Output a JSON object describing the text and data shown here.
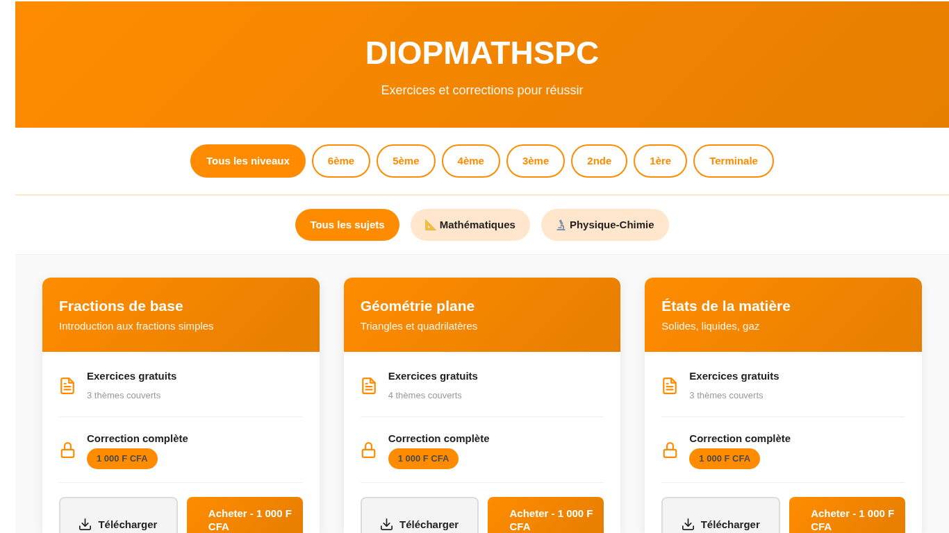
{
  "header": {
    "title": "DIOPMATHSPC",
    "subtitle": "Exercices et corrections pour réussir"
  },
  "level_filters": [
    {
      "label": "Tous les niveaux",
      "selected": true
    },
    {
      "label": "6ème",
      "selected": false
    },
    {
      "label": "5ème",
      "selected": false
    },
    {
      "label": "4ème",
      "selected": false
    },
    {
      "label": "3ème",
      "selected": false
    },
    {
      "label": "2nde",
      "selected": false
    },
    {
      "label": "1ère",
      "selected": false
    },
    {
      "label": "Terminale",
      "selected": false
    }
  ],
  "subject_filters": [
    {
      "kind": "all",
      "label": "Tous les sujets",
      "selected": true
    },
    {
      "kind": "mathematics",
      "label": "Mathématiques",
      "selected": false
    },
    {
      "kind": "physics",
      "label": "Physique-Chimie",
      "selected": false
    }
  ],
  "courses": [
    {
      "title": "Fractions de base",
      "subtitle": "Introduction aux fractions simples",
      "exercises": {
        "label": "Exercices gratuits",
        "detail": "3 thèmes couverts"
      },
      "correction": {
        "label": "Correction complète",
        "price": "1 000 F CFA"
      },
      "buttons": [
        {
          "kind": "download",
          "label": "Télécharger"
        },
        {
          "kind": "buy",
          "label": "Acheter - 1 000 F CFA"
        }
      ]
    },
    {
      "title": "Géométrie plane",
      "subtitle": "Triangles et quadrilatères",
      "exercises": {
        "label": "Exercices gratuits",
        "detail": "4 thèmes couverts"
      },
      "correction": {
        "label": "Correction complète",
        "price": "1 000 F CFA"
      },
      "buttons": [
        {
          "kind": "download",
          "label": "Télécharger"
        },
        {
          "kind": "buy",
          "label": "Acheter - 1 000 F CFA"
        }
      ]
    },
    {
      "title": "États de la matière",
      "subtitle": "Solides, liquides, gaz",
      "exercises": {
        "label": "Exercices gratuits",
        "detail": "3 thèmes couverts"
      },
      "correction": {
        "label": "Correction complète",
        "price": "1 000 F CFA"
      },
      "buttons": [
        {
          "kind": "download",
          "label": "Télécharger"
        },
        {
          "kind": "buy",
          "label": "Acheter - 1 000 F CFA"
        }
      ]
    }
  ]
}
